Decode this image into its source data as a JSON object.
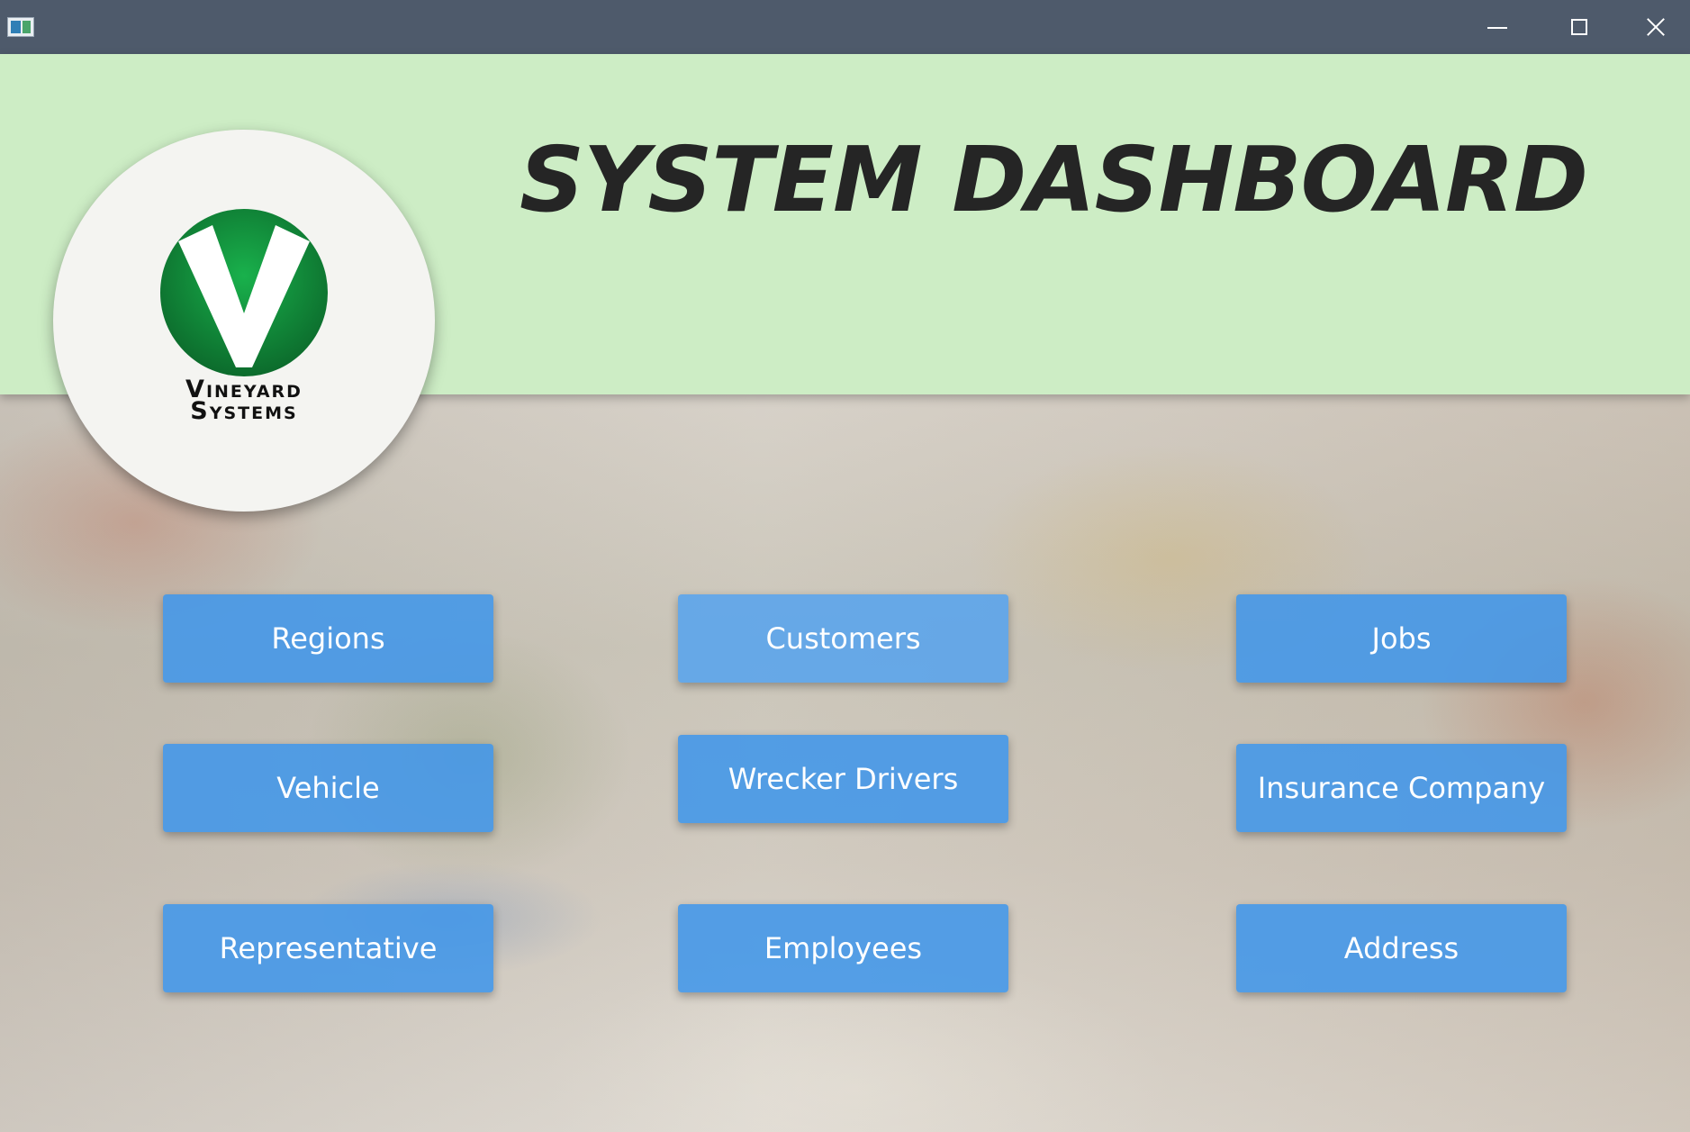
{
  "window": {
    "app_icon": "window-icon",
    "controls": {
      "minimize_icon": "minimize-icon",
      "maximize_icon": "maximize-icon",
      "close_icon": "close-icon"
    }
  },
  "header": {
    "title": "SYSTEM DASHBOARD",
    "background_color": "#cdedc5"
  },
  "logo": {
    "brand_line1": "Vineyard",
    "brand_line2": "Systems",
    "mark_color": "#0f8a3c"
  },
  "buttons": {
    "regions": "Regions",
    "customers": "Customers",
    "jobs": "Jobs",
    "vehicle": "Vehicle",
    "wrecker_drivers": "Wrecker Drivers",
    "insurance_company": "Insurance Company",
    "representative": "Representative",
    "employees": "Employees",
    "address": "Address",
    "color": "#4196e9"
  }
}
